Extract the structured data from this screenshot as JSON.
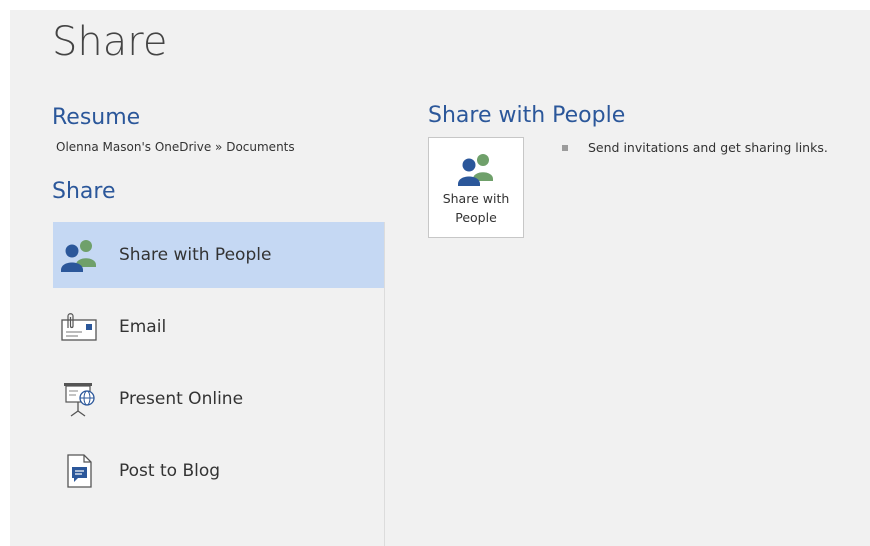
{
  "page": {
    "title": "Share"
  },
  "resume": {
    "heading": "Resume",
    "path": "Olenna Mason's OneDrive » Documents"
  },
  "share": {
    "heading": "Share",
    "items": [
      {
        "label": "Share with People",
        "icon": "share-people-icon",
        "selected": true
      },
      {
        "label": "Email",
        "icon": "email-icon",
        "selected": false
      },
      {
        "label": "Present Online",
        "icon": "present-online-icon",
        "selected": false
      },
      {
        "label": "Post to Blog",
        "icon": "post-to-blog-icon",
        "selected": false
      }
    ]
  },
  "panel": {
    "heading": "Share with People",
    "button_label": "Share with People",
    "description": "Send invitations and get sharing links."
  },
  "colors": {
    "accent": "#2b579a",
    "selected_bg": "#c5d8f3",
    "background": "#f1f1f1"
  }
}
